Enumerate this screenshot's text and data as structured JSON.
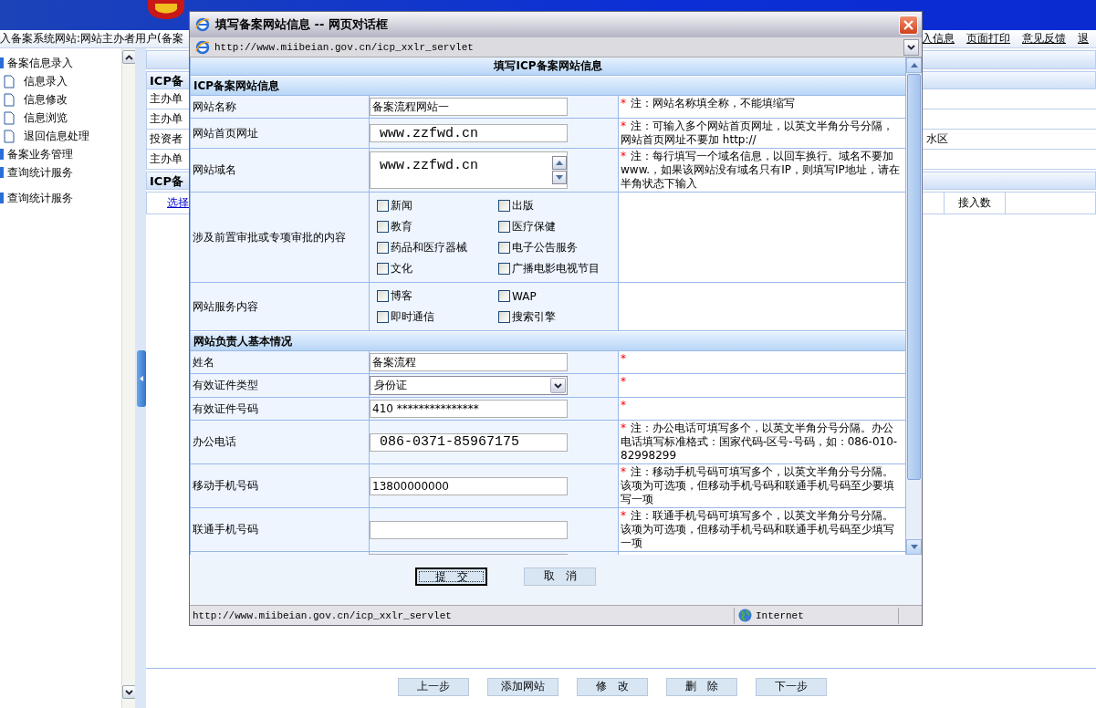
{
  "nav": {
    "user_text": "入备案系统网站:网站主办者用户(备案",
    "links": [
      {
        "label": "入信息"
      },
      {
        "label": "页面打印"
      },
      {
        "label": "意见反馈"
      },
      {
        "label": "退"
      }
    ]
  },
  "sidebar": {
    "items": [
      {
        "label": "备案信息录入",
        "children": [
          {
            "label": "信息录入"
          },
          {
            "label": "信息修改"
          },
          {
            "label": "信息浏览"
          },
          {
            "label": "退回信息处理"
          }
        ]
      },
      {
        "label": "备案业务管理"
      },
      {
        "label": "查询统计服务"
      },
      {
        "label": "查询统计服务"
      }
    ]
  },
  "main": {
    "sections": [
      {
        "title": "ICP备",
        "rows": [
          {
            "label": "主办单"
          },
          {
            "label": "主办单"
          },
          {
            "label": "投资者",
            "value": "水区"
          },
          {
            "label": "主办单"
          }
        ]
      },
      {
        "title": "ICP备",
        "table_header": {
          "link": "选择",
          "column": "接入数"
        }
      }
    ],
    "buttons": [
      "上一步",
      "添加网站",
      "修　改",
      "删　除",
      "下一步"
    ]
  },
  "dialog": {
    "title": "填写备案网站信息 -- 网页对话框",
    "address": "http://www.miibeian.gov.cn/icp_xxlr_servlet",
    "form_title": "填写ICP备案网站信息",
    "sections": [
      {
        "title": "ICP备案网站信息",
        "rows": [
          {
            "kind": "text",
            "label": "网站名称",
            "value": "备案流程网站一",
            "note": {
              "mark": "*",
              "text": "注：网站名称填全称，不能填缩写"
            }
          },
          {
            "kind": "big-text",
            "label": "网站首页网址",
            "value": "www.zzfwd.cn",
            "note": {
              "mark": "*",
              "text": "注：可输入多个网站首页网址，以英文半角分号分隔，网站首页网址不要加 http://"
            }
          },
          {
            "kind": "textarea",
            "label": "网站域名",
            "value": "www.zzfwd.cn",
            "note": {
              "mark": "*",
              "text": "注：每行填写一个域名信息，以回车换行。域名不要加 www.，如果该网站没有域名只有IP，则填写IP地址，请在半角状态下输入"
            }
          },
          {
            "kind": "checks",
            "label": "涉及前置审批或专项审批的内容",
            "options": [
              {
                "label": "新闻",
                "checked": false
              },
              {
                "label": "出版",
                "checked": false
              },
              {
                "label": "教育",
                "checked": false
              },
              {
                "label": "医疗保健",
                "checked": false
              },
              {
                "label": "药品和医疗器械",
                "checked": false
              },
              {
                "label": "电子公告服务",
                "checked": false
              },
              {
                "label": "文化",
                "checked": false
              },
              {
                "label": "广播电影电视节目",
                "checked": false
              }
            ]
          },
          {
            "kind": "checks",
            "label": "网站服务内容",
            "options": [
              {
                "label": "博客",
                "checked": false
              },
              {
                "label": "WAP",
                "checked": false
              },
              {
                "label": "即时通信",
                "checked": false
              },
              {
                "label": "搜索引擎",
                "checked": false
              }
            ]
          }
        ]
      },
      {
        "title": "网站负责人基本情况",
        "rows": [
          {
            "kind": "text",
            "label": "姓名",
            "value": "备案流程",
            "note": {
              "mark": "*"
            }
          },
          {
            "kind": "select",
            "label": "有效证件类型",
            "value": "身份证",
            "note": {
              "mark": "*"
            }
          },
          {
            "kind": "text",
            "label": "有效证件号码",
            "value": "410 ***************",
            "note": {
              "mark": "*"
            }
          },
          {
            "kind": "big-text",
            "label": "办公电话",
            "value": "086-0371-85967175",
            "note": {
              "mark": "*",
              "text": "注：办公电话可填写多个，以英文半角分号分隔。办公电话填写标准格式：国家代码-区号-号码，如：086-010-82998299"
            }
          },
          {
            "kind": "text",
            "label": "移动手机号码",
            "value": "13800000000",
            "note": {
              "mark": "*",
              "text": "注：移动手机号码可填写多个，以英文半角分号分隔。该项为可选项，但移动手机号码和联通手机号码至少要填写一项"
            }
          },
          {
            "kind": "text",
            "label": "联通手机号码",
            "value": "",
            "note": {
              "mark": "*",
              "text": "注：联通手机号码可填写多个，以英文半角分号分隔。该项为可选项，但移动手机号码和联通手机号码至少填写一项"
            }
          },
          {
            "kind": "clipped"
          }
        ]
      }
    ],
    "buttons": [
      {
        "label": "提　交",
        "focused": true
      },
      {
        "label": "取　消",
        "focused": false
      }
    ],
    "status": {
      "url": "http://www.miibeian.gov.cn/icp_xxlr_servlet",
      "zone": "Internet"
    }
  }
}
